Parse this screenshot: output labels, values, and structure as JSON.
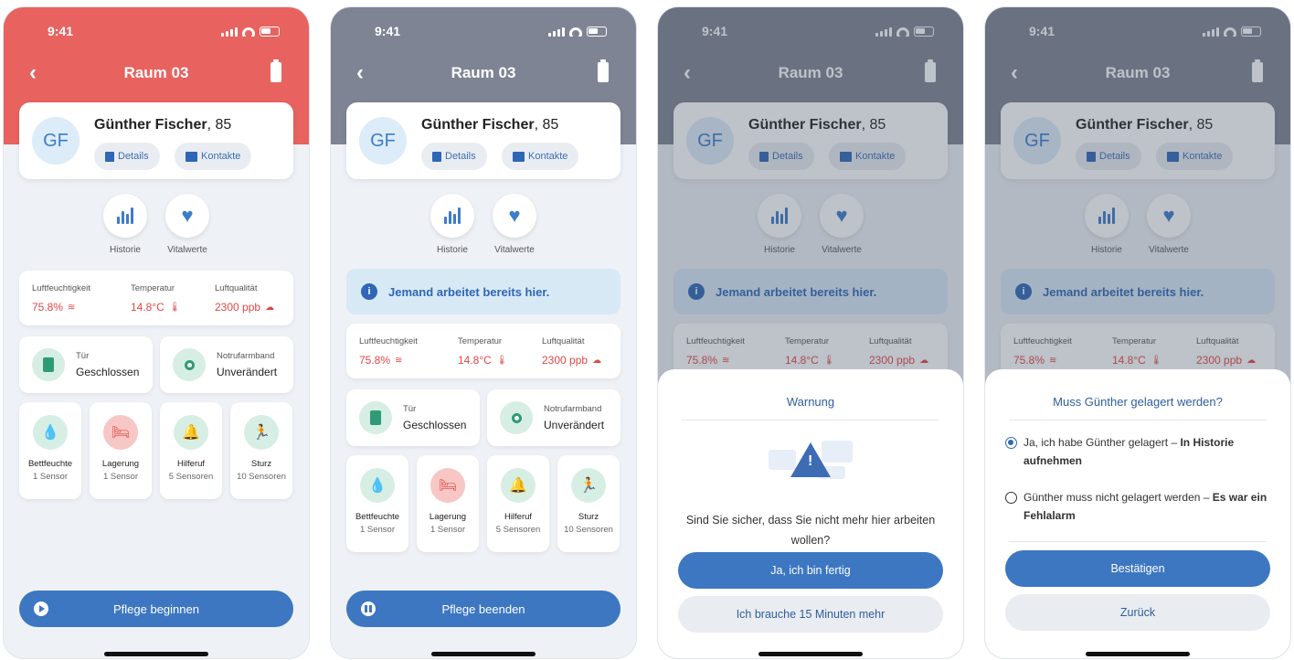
{
  "status": {
    "time": "9:41"
  },
  "header": {
    "back": "‹",
    "room": "Raum 03"
  },
  "patient": {
    "initials": "GF",
    "name": "Günther Fischer",
    "age": ", 85",
    "details": "Details",
    "kontakte": "Kontakte"
  },
  "quick": {
    "historie": "Historie",
    "vitalwerte": "Vitalwerte"
  },
  "info_banner": "Jemand arbeitet bereits hier.",
  "env": {
    "humidity_label": "Luftfeuchtigkeit",
    "humidity_value": "75.8%",
    "temp_label": "Temperatur",
    "temp_value": "14.8°C",
    "air_label": "Luftqualität",
    "air_value": "2300 ppb"
  },
  "door": {
    "label": "Tür",
    "value": "Geschlossen"
  },
  "band": {
    "label": "Notrufarmband",
    "value": "Unverändert"
  },
  "sensors": [
    {
      "name": "Bettfeuchte",
      "count": "1 Sensor"
    },
    {
      "name": "Lagerung",
      "count": "1 Sensor"
    },
    {
      "name": "Hilferuf",
      "count": "5 Sensoren"
    },
    {
      "name": "Sturz",
      "count": "10 Sensoren"
    }
  ],
  "cta": {
    "start": "Pflege beginnen",
    "end": "Pflege beenden"
  },
  "warning_sheet": {
    "title": "Warnung",
    "question": "Sind Sie sicher, dass Sie nicht mehr hier arbeiten wollen?",
    "confirm": "Ja, ich bin fertig",
    "more_time": "Ich brauche 15 Minuten mehr"
  },
  "position_sheet": {
    "title": "Muss Günther gelagert werden?",
    "option1_text": "Ja, ich habe Günther gelagert – ",
    "option1_bold": "In Historie aufnehmen",
    "option2_text": "Günther muss nicht gelagert werden – ",
    "option2_bold": "Es war ein Fehlalarm",
    "selected_option": 1,
    "confirm": "Bestätigen",
    "back": "Zurück"
  },
  "colors": {
    "alert_header": "#e8625f",
    "neutral_header": "#7e8493",
    "primary": "#3d77c2",
    "alert_text": "#e04845",
    "sensor_green": "#2f9a78"
  },
  "icons": [
    "back-chevron-icon",
    "battery-icon",
    "document-icon",
    "contact-card-icon",
    "bar-chart-icon",
    "heart-pulse-icon",
    "info-icon",
    "humidity-icon",
    "thermometer-icon",
    "air-quality-icon",
    "door-icon",
    "watch-icon",
    "drops-icon",
    "bed-icon",
    "bell-icon",
    "fall-icon",
    "play-icon",
    "pause-icon",
    "warning-icon",
    "radio-icon"
  ]
}
